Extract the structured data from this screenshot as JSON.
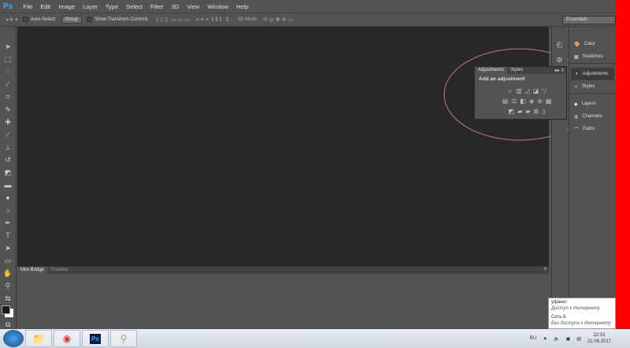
{
  "app": {
    "logo": "Ps"
  },
  "menu": [
    "File",
    "Edit",
    "Image",
    "Layer",
    "Type",
    "Select",
    "Filter",
    "3D",
    "View",
    "Window",
    "Help"
  ],
  "options": {
    "auto_select_label": "Auto-Select:",
    "auto_select_value": "Group",
    "show_transform_label": "Show Transform Controls",
    "mode_3d_label": "3D Mode:",
    "workspace": "Essentials"
  },
  "adjustments_panel": {
    "tabs": [
      "Adjustments",
      "Styles"
    ],
    "title": "Add an adjustment"
  },
  "right_panel": {
    "items": [
      "Color",
      "Swatches",
      "Adjustments",
      "Styles",
      "Layers",
      "Channels",
      "Paths"
    ],
    "active": "Adjustments"
  },
  "bottom_panel": {
    "tabs": [
      "Mini Bridge",
      "Timeline"
    ]
  },
  "tooltip": {
    "net1": "уфанет",
    "net1_status": "Доступ к Интернету",
    "net2": "Сеть 8",
    "net2_status": "Без доступа к Интернету"
  },
  "tray": {
    "lang": "RU",
    "time": "22:53",
    "date": "21.06.2017"
  },
  "colors": {
    "canvas": "#282828",
    "panel": "#535353",
    "accent": "#3fa9f5"
  }
}
